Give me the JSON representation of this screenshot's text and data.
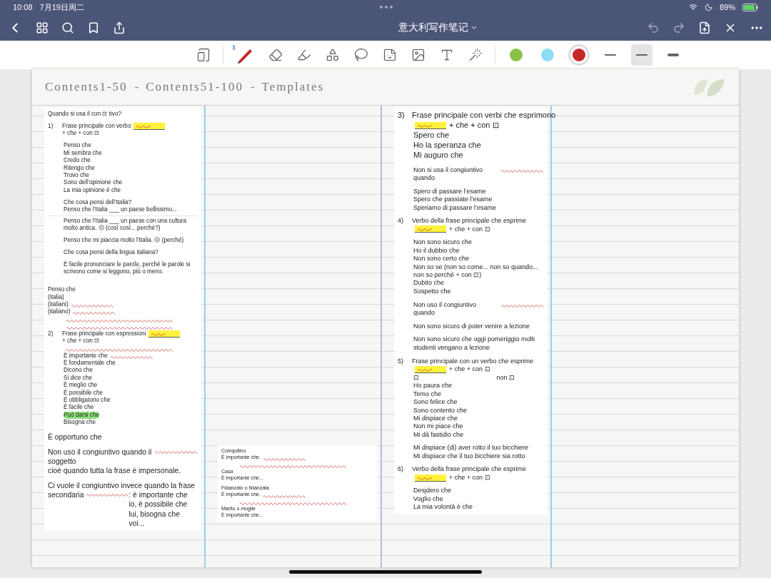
{
  "status_bar": {
    "time": "10:08",
    "date": "7月19日周二",
    "battery": "89%"
  },
  "nav_bar": {
    "title": "意大利写作笔记"
  },
  "toolbar": {
    "tools": [
      {
        "kind": "page",
        "selected": false
      },
      {
        "kind": "pen",
        "selected": true
      },
      {
        "kind": "eraser",
        "selected": false
      },
      {
        "kind": "highlighter",
        "selected": false
      },
      {
        "kind": "shapes",
        "selected": false
      },
      {
        "kind": "lasso",
        "selected": false
      },
      {
        "kind": "sticker",
        "selected": false
      },
      {
        "kind": "image",
        "selected": false
      },
      {
        "kind": "textbox",
        "selected": false
      },
      {
        "kind": "laser",
        "selected": false
      }
    ],
    "colors": [
      {
        "color": "#8bc34a",
        "selected": false
      },
      {
        "color": "#8fdcf5",
        "selected": false
      },
      {
        "color": "#c62828",
        "selected": true
      }
    ],
    "strokes": [
      {
        "kind": "thin",
        "selected": false
      },
      {
        "kind": "medium",
        "selected": true
      },
      {
        "kind": "thick",
        "selected": false
      }
    ]
  },
  "page": {
    "header": {
      "links": [
        "Contents1-50",
        "Contents51-100",
        "Templates"
      ],
      "separator": "-"
    },
    "columns": [
      {
        "cards": [
          {
            "kind": "small",
            "blocks": [
              {
                "kind": "plain",
                "text": "Quando si usa il con ⊡ tivo?"
              },
              {
                "kind": "gap"
              },
              {
                "kind": "numbered",
                "number": "1)",
                "text": "Frase principale con verbo",
                "blank": true,
                "after": "+ che + con ⊡"
              },
              {
                "kind": "gap"
              },
              {
                "kind": "line",
                "text": "Penso che"
              },
              {
                "kind": "line",
                "text": "Mi sembra che"
              },
              {
                "kind": "line",
                "text": "Credo che"
              },
              {
                "kind": "line",
                "text": "Ritengo che"
              },
              {
                "kind": "line",
                "text": "Trovo che"
              },
              {
                "kind": "line",
                "text": "Sono dell’opinione che"
              },
              {
                "kind": "line",
                "text": "La mia opinione è che"
              },
              {
                "kind": "gap"
              },
              {
                "kind": "line",
                "text": "Che cosa pensi dell’Italia?"
              },
              {
                "kind": "line",
                "text": "Penso che l’Italia ___ un paese bellissimo..."
              },
              {
                "kind": "rule"
              },
              {
                "kind": "line",
                "text": "Penso che l’Italia ___ un paese con una cultura molto antica. ☹ (così così... perché?)"
              },
              {
                "kind": "gap"
              },
              {
                "kind": "line",
                "text": "Penso che mi piaccia molto l’Italia. ☹ (perché)"
              },
              {
                "kind": "gap"
              },
              {
                "kind": "line",
                "text": "Che cosa pensi della lingua italiana?"
              },
              {
                "kind": "gap"
              },
              {
                "kind": "line",
                "text": "È facile pronunciare le parole, perché le parole si scrivono come si leggono, più o meno."
              }
            ]
          },
          {
            "kind": "small",
            "blocks": [
              {
                "kind": "gap"
              },
              {
                "kind": "plain",
                "text": "Penso che"
              },
              {
                "kind": "plain",
                "text": "(Italia)"
              },
              {
                "kind": "plain",
                "text": "(italiani)",
                "annotated": true
              },
              {
                "kind": "plain",
                "text": "(italiano)",
                "annotated": true
              },
              {
                "kind": "scribble"
              },
              {
                "kind": "scribble"
              },
              {
                "kind": "numbered",
                "number": "2)",
                "text": "Frase principale con espressioni",
                "blank": true,
                "after": "+ che + con ⊡"
              },
              {
                "kind": "scribble"
              },
              {
                "kind": "line",
                "text": "È importante che",
                "annotated": true
              },
              {
                "kind": "line",
                "text": "È fondamentale che"
              },
              {
                "kind": "line",
                "text": "Dicono che"
              },
              {
                "kind": "line",
                "text": "Si dice che"
              },
              {
                "kind": "line",
                "text": "È meglio che"
              },
              {
                "kind": "line",
                "text": "È possibile che"
              },
              {
                "kind": "line",
                "text": "È obbligatorio che"
              },
              {
                "kind": "line",
                "text": "È facile che"
              },
              {
                "kind": "line",
                "text": "Può darsi che",
                "highlighted": true
              },
              {
                "kind": "line",
                "text": "Bisogna che"
              }
            ]
          },
          {
            "kind": "big",
            "blocks": [
              {
                "kind": "plain",
                "text": "È opportuno che"
              },
              {
                "kind": "gap"
              },
              {
                "kind": "plain",
                "text": "Non uso il congiuntivo quando il soggetto",
                "annotated": true
              },
              {
                "kind": "plain",
                "text": "cioè quando tutta la frase è impersonale."
              },
              {
                "kind": "gap"
              },
              {
                "kind": "plain",
                "text": "Ci vuole il congiuntivo invece quando la frase"
              },
              {
                "kind": "plain",
                "text": "secondaria",
                "annotated": true,
                "after": ": è importante che io, è possibile che lui, bisogna che voi..."
              }
            ]
          }
        ]
      },
      {
        "cards": [
          {
            "kind": "tiny",
            "blocks": [
              {
                "kind": "plain",
                "text": "Coinquilino"
              },
              {
                "kind": "plain",
                "text": "È importante che.",
                "annotated": true
              },
              {
                "kind": "scribble"
              },
              {
                "kind": "plain",
                "text": "Casa"
              },
              {
                "kind": "plain",
                "text": "È importante che..."
              },
              {
                "kind": "gap"
              },
              {
                "kind": "plain",
                "text": "Fidanzato o fidanzata"
              },
              {
                "kind": "plain",
                "text": "È importante che.",
                "annotated": true
              },
              {
                "kind": "scribble"
              },
              {
                "kind": "plain",
                "text": "Marito o moglie"
              },
              {
                "kind": "plain",
                "text": "È importante che..."
              }
            ]
          }
        ]
      },
      {
        "cards": [
          {
            "kind": "large",
            "blocks": [
              {
                "kind": "numbered",
                "number": "3)",
                "text": "Frase principale con verbi che esprimono",
                "blank": true,
                "after": "+ che + con ⊡"
              },
              {
                "kind": "line",
                "text": "Spero che"
              },
              {
                "kind": "line",
                "text": "Ho la speranza che"
              },
              {
                "kind": "line",
                "text": "Mi auguro che"
              }
            ]
          },
          {
            "kind": "medium",
            "blocks": [
              {
                "kind": "line",
                "text": "Non si usa il congiuntivo quando",
                "annotated": true
              },
              {
                "kind": "gap"
              },
              {
                "kind": "line",
                "text": "Spero di passare l’esame"
              },
              {
                "kind": "line",
                "text": "Spero che passiate l’esame"
              },
              {
                "kind": "line",
                "text": "Speriamo di passare l’esame"
              },
              {
                "kind": "gap"
              },
              {
                "kind": "numbered",
                "number": "4)",
                "text": "Verbo della frase principale che esprime",
                "blank": true,
                "after": "+ che + con ⊡"
              },
              {
                "kind": "gap"
              },
              {
                "kind": "line",
                "text": "Non sono sicuro che"
              },
              {
                "kind": "line",
                "text": "Ho il dubbio che"
              },
              {
                "kind": "line",
                "text": "Non sono certo che"
              },
              {
                "kind": "line",
                "text": "Non so se (non so come... non so quando... non so perché + con ⊡)"
              },
              {
                "kind": "line",
                "text": "Dubito che"
              },
              {
                "kind": "line",
                "text": "Sospetto che"
              },
              {
                "kind": "gap"
              },
              {
                "kind": "line",
                "text": "Non uso il congiuntivo quando",
                "annotated": true
              },
              {
                "kind": "gap"
              },
              {
                "kind": "line",
                "text": "Non sono sicuro di poter venire a lezione"
              },
              {
                "kind": "gap"
              },
              {
                "kind": "line",
                "text": "Non sono sicuro che oggi pomeriggio molti studenti vengano a lezione"
              }
            ]
          },
          {
            "kind": "medium",
            "blocks": [
              {
                "kind": "numbered",
                "number": "5)",
                "text": "Frase principale con un verbo che esprime",
                "blank": true,
                "after": "+ che + con ⊡"
              },
              {
                "kind": "pair",
                "text": "⊡",
                "after": "non ⊡"
              },
              {
                "kind": "line",
                "text": "Ho paura che"
              },
              {
                "kind": "line",
                "text": "Temo che"
              },
              {
                "kind": "line",
                "text": "Sono felice che"
              },
              {
                "kind": "line",
                "text": "Sono contento che"
              },
              {
                "kind": "line",
                "text": "Mi dispiace che"
              },
              {
                "kind": "line",
                "text": "Non mi piace che"
              },
              {
                "kind": "line",
                "text": "Mi dà fastidio che"
              },
              {
                "kind": "gap"
              },
              {
                "kind": "line",
                "text": "Mi dispiace (di) aver rotto il tuo bicchiere"
              },
              {
                "kind": "line",
                "text": "Mi dispiace che il tuo bicchiere sia rotto"
              },
              {
                "kind": "gap"
              },
              {
                "kind": "numbered",
                "number": "6)",
                "text": "Verbo della frase principale che esprime",
                "blank": true,
                "after": "+ che + con ⊡"
              },
              {
                "kind": "gap"
              },
              {
                "kind": "line",
                "text": "Desjdero che"
              },
              {
                "kind": "line",
                "text": "Voglio che"
              },
              {
                "kind": "line",
                "text": "La mia volontà è che"
              }
            ]
          }
        ]
      }
    ]
  }
}
